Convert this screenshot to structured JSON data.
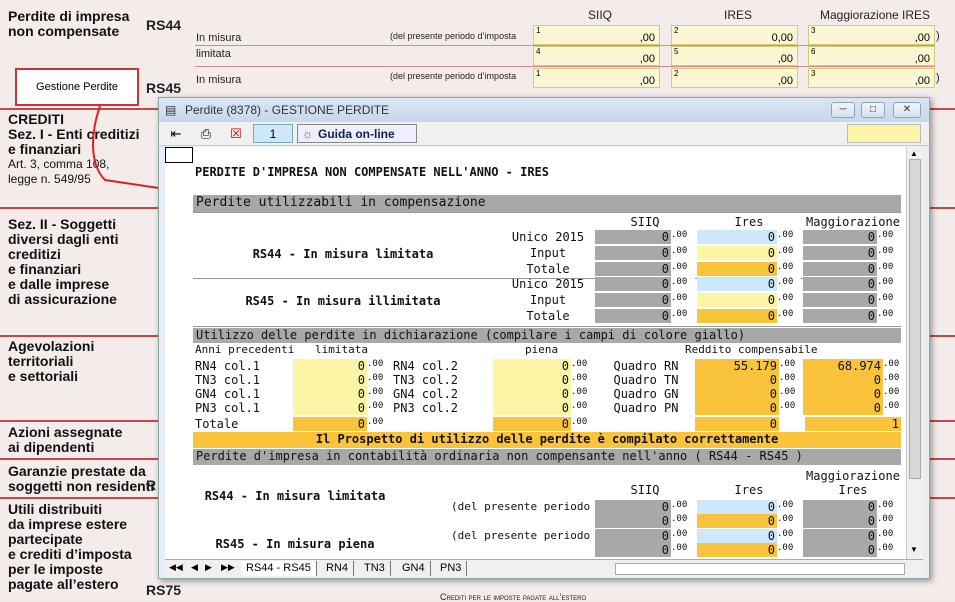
{
  "background": {
    "sections": [
      {
        "id": "perdite",
        "lines": [
          "Perdite di impresa",
          "non compensate"
        ]
      },
      {
        "id": "crediti",
        "lines": [
          "CREDITI",
          "Sez. I - Enti creditizi",
          "e finanziari"
        ],
        "sub": [
          "Art. 3, comma 108,",
          "legge n. 549/95"
        ]
      },
      {
        "id": "sez2",
        "lines": [
          "Sez. II - Soggetti",
          "diversi dagli enti",
          "creditizi",
          "e finanziari",
          "e dalle imprese",
          "di assicurazione"
        ]
      },
      {
        "id": "agev",
        "lines": [
          "Agevolazioni",
          "territoriali",
          "e settoriali"
        ]
      },
      {
        "id": "azioni",
        "lines": [
          "Azioni assegnate",
          "ai dipendenti"
        ]
      },
      {
        "id": "garanzie",
        "lines": [
          "Garanzie prestate da",
          "soggetti non residenti"
        ]
      },
      {
        "id": "utili",
        "lines": [
          "Utili distribuiti",
          "da imprese estere",
          "partecipate",
          "e crediti d’imposta",
          "per le imposte",
          "pagate all’estero"
        ]
      }
    ],
    "rs44": "RS44",
    "rs45": "RS45",
    "rs75": "RS75",
    "rs_letter": "R",
    "headers": {
      "siiq": "SIIQ",
      "ires": "IRES",
      "magg": "Maggiorazione IRES"
    },
    "in_misura": "In misura",
    "limitata": "limitata",
    "presente_periodo": "(del presente periodo d’imposta",
    "box_nums": [
      "1",
      "2",
      "3",
      "4",
      "5",
      "6"
    ],
    "box_vals": [
      ",00",
      "0,00",
      ",00",
      ",00",
      ",00",
      ",00"
    ],
    "paren": ")",
    "gestione_button": "Gestione Perdite",
    "crediti_footer": "Crediti per le imposte pagate all’estero"
  },
  "dialog": {
    "title": "Perdite (8378) - GESTIONE PERDITE",
    "page_num": "1",
    "guida": "Guida on-line",
    "heading": "PERDITE D'IMPRESA NON COMPENSATE NELL'ANNO - IRES",
    "sec1": "Perdite utilizzabili in compensazione",
    "cols": {
      "siiq": "SIIQ",
      "ires": "Ires",
      "magg": "Maggiorazione"
    },
    "rs44_lim": "RS44 - In misura limitata",
    "rs45_ill": "RS45 - In misura illimitata",
    "rowlabels": [
      "Unico 2015",
      "Input",
      "Totale"
    ],
    "zero": "0",
    "dec": ".00",
    "sec2": "Utilizzo delle perdite in dichiarazione (compilare i campi di colore giallo)",
    "sub2": {
      "anni": "Anni precedenti",
      "limitata": "limitata",
      "piena": "piena",
      "reddito": "Reddito compensabile"
    },
    "utilizzo_rows": [
      {
        "a": "RN4 col.1",
        "b": "RN4 col.2",
        "c": "Quadro RN",
        "v1": "55.179",
        "v2": "68.974"
      },
      {
        "a": "TN3 col.1",
        "b": "TN3 col.2",
        "c": "Quadro TN",
        "v1": "0",
        "v2": "0"
      },
      {
        "a": "GN4 col.1",
        "b": "GN4 col.2",
        "c": "Quadro GN",
        "v1": "0",
        "v2": "0"
      },
      {
        "a": "PN3 col.1",
        "b": "PN3 col.2",
        "c": "Quadro PN",
        "v1": "0",
        "v2": "0"
      }
    ],
    "totale": "Totale",
    "one": "1",
    "ok_msg": "Il Prospetto di utilizzo delle perdite è compilato correttamente",
    "sec3": "Perdite d'impresa in contabilità ordinaria non compensante nell'anno ( RS44 - RS45 )",
    "cols3": {
      "siiq": "SIIQ",
      "ires": "Ires",
      "magg1": "Maggiorazione",
      "magg2": "Ires"
    },
    "rs44_b": "RS44 - In misura limitata",
    "rs45_b": "RS45 - In misura piena",
    "presente": "(del presente periodo",
    "tabs": [
      "RS44 - RS45",
      "RN4",
      "TN3",
      "GN4",
      "PN3"
    ]
  }
}
